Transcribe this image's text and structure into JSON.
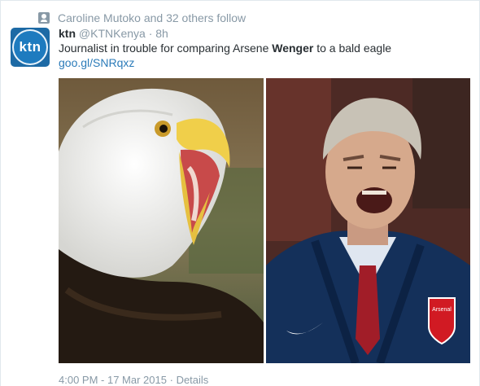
{
  "context": {
    "text": "Caroline Mutoko and 32 others follow",
    "icon": "person-icon"
  },
  "avatar": {
    "logo_text": "ktn"
  },
  "tweet": {
    "name": "ktn",
    "handle": "@KTNKenya",
    "separator": "·",
    "time": "8h",
    "text_before": "Journalist in trouble for comparing Arsene ",
    "text_bold": "Wenger",
    "text_after": " to a bald eagle",
    "link": "goo.gl/SNRqxz"
  },
  "media": {
    "left_alt": "bald eagle with open beak",
    "right_alt": "man shouting in navy coat",
    "badge_text": "Arsenal"
  },
  "footer": {
    "timestamp": "4:00 PM - 17 Mar 2015",
    "separator": "·",
    "details_label": "Details"
  },
  "colors": {
    "link": "#2b7bb9",
    "muted": "#8899a6",
    "brand": "#1d6aa5"
  }
}
